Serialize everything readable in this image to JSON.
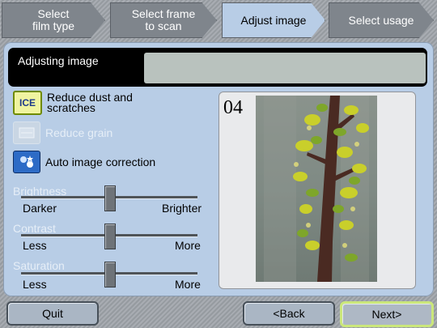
{
  "steps": {
    "s1": "Select\nfilm type",
    "s2": "Select frame\nto scan",
    "s3": "Adjust image",
    "s4": "Select usage"
  },
  "header": {
    "title": "Adjusting image",
    "status": ""
  },
  "options": {
    "dust": {
      "label": "Reduce dust and\nscratches",
      "icon": "ICE",
      "enabled": true
    },
    "grain": {
      "label": "Reduce grain",
      "icon": "grain-icon",
      "enabled": false
    },
    "auto": {
      "label": "Auto image correction",
      "icon": "auto-correction-icon",
      "enabled": true
    }
  },
  "sliders": {
    "brightness": {
      "title": "Brightness",
      "left": "Darker",
      "right": "Brighter",
      "level": 0.5
    },
    "contrast": {
      "title": "Contrast",
      "left": "Less",
      "right": "More",
      "level": 0.5
    },
    "saturation": {
      "title": "Saturation",
      "left": "Less",
      "right": "More",
      "level": 0.5
    }
  },
  "preview": {
    "frame_number": "04"
  },
  "buttons": {
    "quit": "Quit",
    "back": "<Back",
    "next": "Next>"
  },
  "colors": {
    "panel": "#b8cde6",
    "active_step": "#b8cde6",
    "inactive_step": "#7f858c",
    "next_border": "#cbe77b"
  }
}
